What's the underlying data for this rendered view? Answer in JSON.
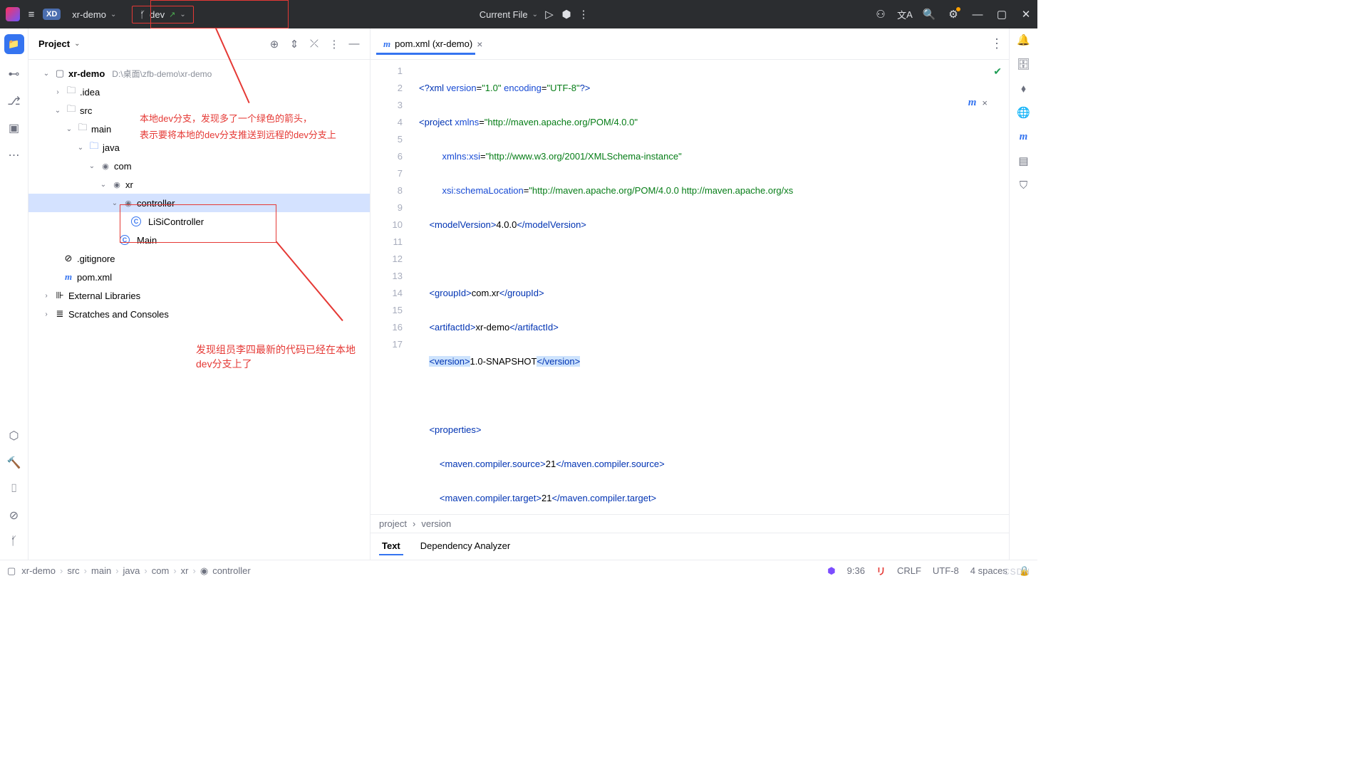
{
  "header": {
    "project": "xr-demo",
    "branch": "dev",
    "run_target": "Current File"
  },
  "annotations": {
    "text1_line1": "本地dev分支，发现多了一个绿色的箭头，",
    "text1_line2": "表示要将本地的dev分支推送到远程的dev分支上",
    "text2": "发现组员李四最新的代码已经在本地dev分支上了"
  },
  "project_panel": {
    "title": "Project",
    "root": "xr-demo",
    "root_path": "D:\\桌面\\zfb-demo\\xr-demo",
    "idea": ".idea",
    "src": "src",
    "main": "main",
    "java": "java",
    "com": "com",
    "xr": "xr",
    "controller": "controller",
    "lisi": "LiSiController",
    "main_class": "Main",
    "gitignore": ".gitignore",
    "pom": "pom.xml",
    "ext_lib": "External Libraries",
    "scratches": "Scratches and Consoles"
  },
  "editor": {
    "tab_label": "pom.xml (xr-demo)",
    "lines": [
      1,
      2,
      3,
      4,
      5,
      6,
      7,
      8,
      9,
      10,
      11,
      12,
      13,
      14,
      15,
      16,
      17
    ],
    "sub_breadcrumb": [
      "project",
      "version"
    ],
    "subtabs": {
      "text": "Text",
      "dep": "Dependency Analyzer"
    }
  },
  "status": {
    "crumbs": [
      "xr-demo",
      "src",
      "main",
      "java",
      "com",
      "xr",
      "controller"
    ],
    "time": "9:36",
    "eol": "CRLF",
    "enc": "UTF-8",
    "indent": "4 spaces"
  },
  "watermark": "CSDN"
}
